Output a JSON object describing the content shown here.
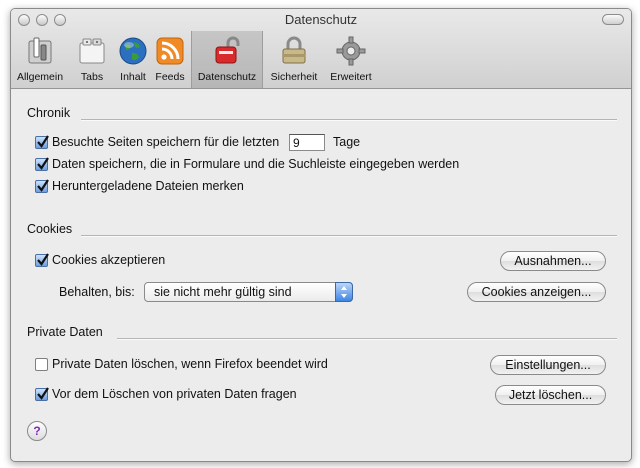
{
  "window": {
    "title": "Datenschutz"
  },
  "toolbar": {
    "items": [
      {
        "label": "Allgemein",
        "icon": "switch-icon"
      },
      {
        "label": "Tabs",
        "icon": "tabs-icon"
      },
      {
        "label": "Inhalt",
        "icon": "globe-icon"
      },
      {
        "label": "Feeds",
        "icon": "rss-feed-icon"
      },
      {
        "label": "Datenschutz",
        "icon": "privacy-lock-icon",
        "selected": true
      },
      {
        "label": "Sicherheit",
        "icon": "padlock-icon"
      },
      {
        "label": "Erweitert",
        "icon": "gear-icon"
      }
    ]
  },
  "history": {
    "heading": "Chronik",
    "remember_visited_pre": "Besuchte Seiten speichern für die letzten",
    "remember_visited_days": "9",
    "remember_visited_post": "Tage",
    "remember_visited_checked": true,
    "save_forms": "Daten speichern, die in Formulare und die Suchleiste eingegeben werden",
    "save_forms_checked": true,
    "remember_downloads": "Heruntergeladene Dateien merken",
    "remember_downloads_checked": true
  },
  "cookies": {
    "heading": "Cookies",
    "accept": "Cookies akzeptieren",
    "accept_checked": true,
    "exceptions_button": "Ausnahmen...",
    "keep_until_label": "Behalten, bis:",
    "keep_until_value": "sie nicht mehr gültig sind",
    "show_cookies_button": "Cookies anzeigen..."
  },
  "private_data": {
    "heading": "Private Daten",
    "clear_on_exit": "Private Daten löschen, wenn Firefox beendet wird",
    "clear_on_exit_checked": false,
    "settings_button": "Einstellungen...",
    "ask_before": "Vor dem Löschen von privaten Daten fragen",
    "ask_before_checked": true,
    "clear_now_button": "Jetzt löschen..."
  },
  "help": {
    "label": "?"
  },
  "colors": {
    "checkbox_accent": "#6c9fe0",
    "help_glyph": "#7a2fb5"
  }
}
